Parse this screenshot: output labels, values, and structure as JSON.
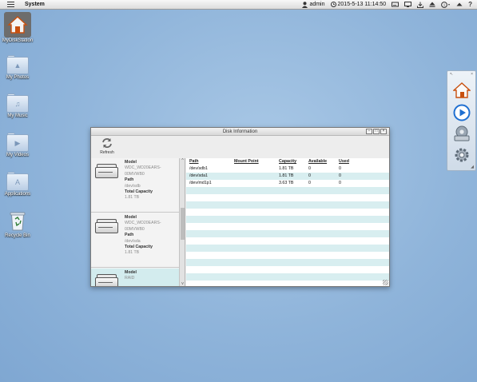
{
  "topbar": {
    "system_label": "System",
    "username": "admin",
    "datetime": "2015-5-13 11:14:50"
  },
  "desktop": {
    "icons": [
      {
        "label": "MyDiskStation",
        "kind": "home"
      },
      {
        "label": "My Photos",
        "kind": "folder",
        "glyph": "▲"
      },
      {
        "label": "My Music",
        "kind": "folder",
        "glyph": "♫"
      },
      {
        "label": "My Videos",
        "kind": "folder",
        "glyph": "▶"
      },
      {
        "label": "Applications",
        "kind": "folder",
        "glyph": "A"
      },
      {
        "label": "Recycle Bin",
        "kind": "recycle"
      }
    ]
  },
  "window": {
    "title": "Disk Information",
    "refresh_label": "Refresh",
    "disks": [
      {
        "model_label": "Model",
        "model": "WDC_WD20EARS-00MVWB0",
        "path_label": "Path",
        "path": "/dev/sdb",
        "capacity_label": "Total Capacity",
        "capacity": "1.81 TB"
      },
      {
        "model_label": "Model",
        "model": "WDC_WD20EARS-00MVWB0",
        "path_label": "Path",
        "path": "/dev/sda",
        "capacity_label": "Total Capacity",
        "capacity": "1.81 TB"
      },
      {
        "model_label": "Model",
        "model": "RAID",
        "path_label": "",
        "path": "",
        "capacity_label": "",
        "capacity": ""
      }
    ],
    "columns": {
      "path": "Path",
      "mount": "Mount Point",
      "capacity": "Capacity",
      "available": "Available",
      "used": "Used"
    },
    "rows": [
      {
        "path": "/dev/sdb1",
        "mount": "",
        "capacity": "1.81 TB",
        "available": "0",
        "used": "0"
      },
      {
        "path": "/dev/sda1",
        "mount": "",
        "capacity": "1.81 TB",
        "available": "0",
        "used": "0"
      },
      {
        "path": "/dev/md1p1",
        "mount": "",
        "capacity": "3.63 TB",
        "available": "0",
        "used": "0"
      }
    ],
    "empty_row_count": 14
  },
  "colors": {
    "desktop_bg": "#8fb4da",
    "selected_row": "#d3ecee",
    "stripe": "#d8eef0",
    "accent_blue": "#1f6fd1"
  }
}
